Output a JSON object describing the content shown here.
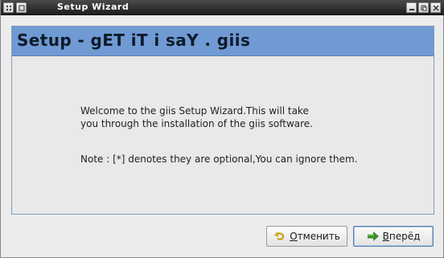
{
  "window": {
    "title": "Setup Wizard"
  },
  "header": {
    "title": "Setup - gET iT i saY . giis"
  },
  "content": {
    "welcome_line1": "Welcome to the giis Setup Wizard.This will take",
    "welcome_line2": "you through the installation of the giis software.",
    "note": "Note : [*] denotes they are optional,You can ignore them."
  },
  "buttons": {
    "cancel_label_first": "О",
    "cancel_label_rest": "тменить",
    "next_label_first": "В",
    "next_label_rest": "перёд"
  },
  "colors": {
    "header_bg": "#6f9ad3",
    "titlebar_bg": "#1e1e1e",
    "next_icon_green": "#3a8a2a",
    "cancel_icon_yellow": "#e6c229"
  },
  "icons": {
    "window_menu": "window-menu-icon",
    "minimize": "minimize-icon",
    "maximize": "maximize-icon",
    "close": "close-icon",
    "cancel": "undo-arrow-icon",
    "next": "right-arrow-icon"
  }
}
